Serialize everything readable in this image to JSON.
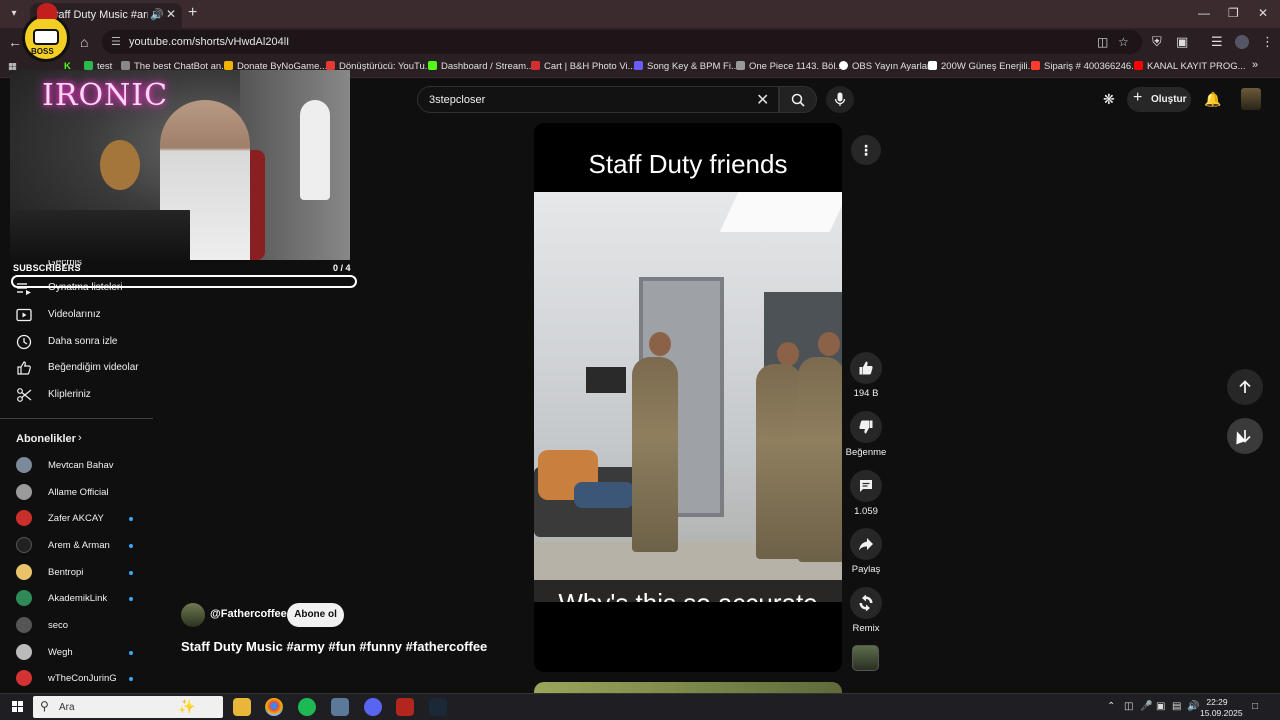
{
  "browser": {
    "tab_title": "Staff Duty Music #army #fun #funny #fathercoffee",
    "url": "youtube.com/shorts/vHwdAl204lI",
    "bookmarks": [
      {
        "label": "test",
        "color": "#2db84b"
      },
      {
        "label": "The best ChatBot an...",
        "color": "#888888"
      },
      {
        "label": "Donate ByNoGame...",
        "color": "#f0b400"
      },
      {
        "label": "Dönüştürücü: YouTu...",
        "color": "#e53935"
      },
      {
        "label": "Dashboard / Stream...",
        "color": "#53fc18"
      },
      {
        "label": "Cart | B&H Photo Vi...",
        "color": "#d32f2f"
      },
      {
        "label": "Song Key & BPM Fi...",
        "color": "#6b5cff"
      },
      {
        "label": "One Piece 1143. Böl...",
        "color": "#999999"
      },
      {
        "label": "OBS Yayın Ayarları",
        "color": "#ffffff"
      },
      {
        "label": "200W Güneş Enerjili...",
        "color": "#ffffff"
      },
      {
        "label": "Sipariş # 400366246...",
        "color": "#ff3b30"
      },
      {
        "label": "KANAL KAYIT PROG...",
        "color": "#ff0000"
      }
    ],
    "bookmark_more": "»"
  },
  "youtube": {
    "search_value": "3stepcloser",
    "create_label": "Oluştur"
  },
  "overlay": {
    "neon_text": "IRONIC",
    "logo_text": "BOSS",
    "subscribers_label": "SUBSCRIBERS",
    "subscribers_count": "0 / 4",
    "subscribers_progress": 0
  },
  "sidebar": {
    "partial_item": "Geçmiş",
    "items": [
      {
        "label": "Oynatma listeleri",
        "icon": "playlist-icon"
      },
      {
        "label": "Videolarınız",
        "icon": "video-icon"
      },
      {
        "label": "Daha sonra izle",
        "icon": "clock-icon"
      },
      {
        "label": "Beğendiğim videolar",
        "icon": "thumbs-up-icon"
      },
      {
        "label": "Klipleriniz",
        "icon": "scissors-icon"
      }
    ],
    "subscriptions_title": "Abonelikler",
    "channels": [
      {
        "name": "Mevtcan Bahav",
        "color": "#7a8a9a",
        "live": false
      },
      {
        "name": "Allame Official",
        "color": "#9a9a9a",
        "live": false
      },
      {
        "name": "Zafer AKCAY",
        "color": "#c9302c",
        "live": true
      },
      {
        "name": "Arem & Arman",
        "color": "#222222",
        "live": true
      },
      {
        "name": "Bentropi",
        "color": "#e8c36a",
        "live": true
      },
      {
        "name": "AkademikLink",
        "color": "#2e8b57",
        "live": true
      },
      {
        "name": "seco",
        "color": "#555555",
        "live": false
      },
      {
        "name": "Wegh",
        "color": "#bbbbbb",
        "live": true
      },
      {
        "name": "wTheConJurinG",
        "color": "#d33333",
        "live": true
      }
    ]
  },
  "video": {
    "title_overlay": "Staff Duty friends",
    "caption_overlay": "Why's this so accurate",
    "channel_handle": "@Fathercoffee",
    "subscribe_label": "Abone ol",
    "title": "Staff Duty Music #army #fun #funny #fathercoffee"
  },
  "actions": {
    "like_count": "194 B",
    "dislike_label": "Beğenme",
    "comment_count": "1.059",
    "share_label": "Paylaş",
    "remix_label": "Remix"
  },
  "taskbar": {
    "search_label": "Ara",
    "time": "22:29",
    "date": "15.09.2025"
  }
}
